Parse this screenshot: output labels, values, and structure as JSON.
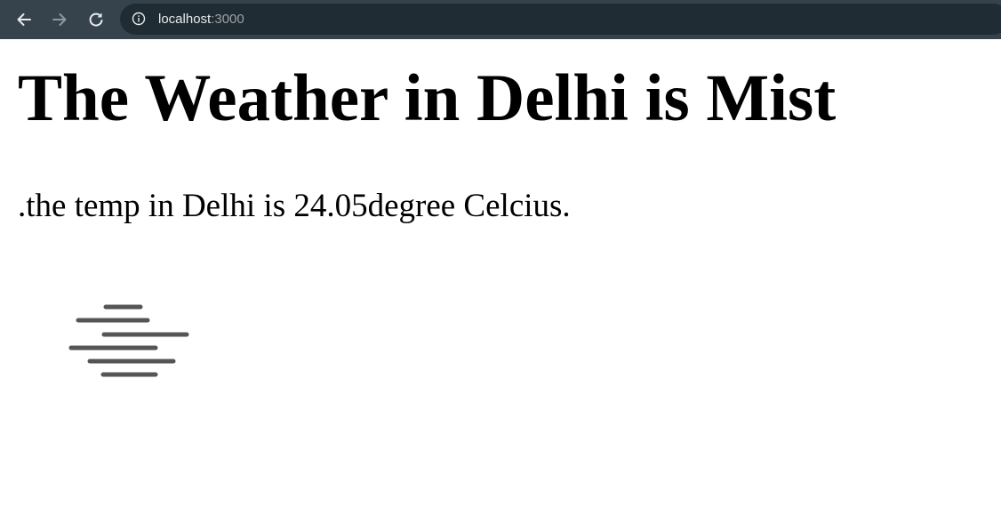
{
  "browser": {
    "url_host": "localhost",
    "url_port": ":3000",
    "icons": [
      "back-arrow-icon",
      "forward-arrow-icon",
      "reload-icon",
      "info-icon"
    ],
    "chrome_color": "#36434c",
    "omnibox_color": "#202c33"
  },
  "page": {
    "heading": "The Weather in Delhi is Mist",
    "temp_text": ".the temp in Delhi is 24.05degree Celcius.",
    "weather_icon": "mist-icon"
  }
}
